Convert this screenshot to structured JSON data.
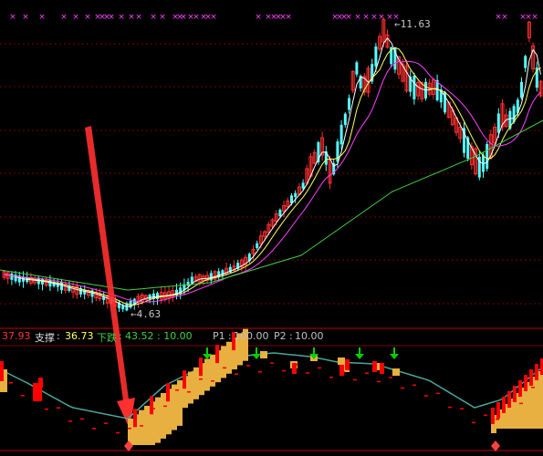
{
  "chart_data": {
    "type": "candlestick",
    "price_high_label": "11.63",
    "price_low_label": "4.63",
    "markers_row": "× × × ×××× × × ×× ×× ×× ××××× ×××× × ×××× × ××× × ×",
    "indicator": {
      "value_red": "37.93",
      "support_label": "支撑",
      "support_value": "36.73",
      "down_label": "下跌",
      "down_value": "43.52 : 10.00",
      "p1_label": "P1",
      "p1_value": "100.00",
      "p2_label": "P2",
      "p2_value": "10.00"
    }
  },
  "colors": {
    "up": "#ff3030",
    "down": "#54ffff",
    "ma_white": "#ffffff",
    "ma_yellow": "#ffff60",
    "ma_magenta": "#ff40ff",
    "ma_green": "#40d040",
    "bar_red": "#ff0000",
    "bar_gold": "#e8b040",
    "osc_line": "#4aa79a",
    "arrow_green": "#00d000",
    "grid": "#7a0000",
    "border": "#c00000"
  }
}
